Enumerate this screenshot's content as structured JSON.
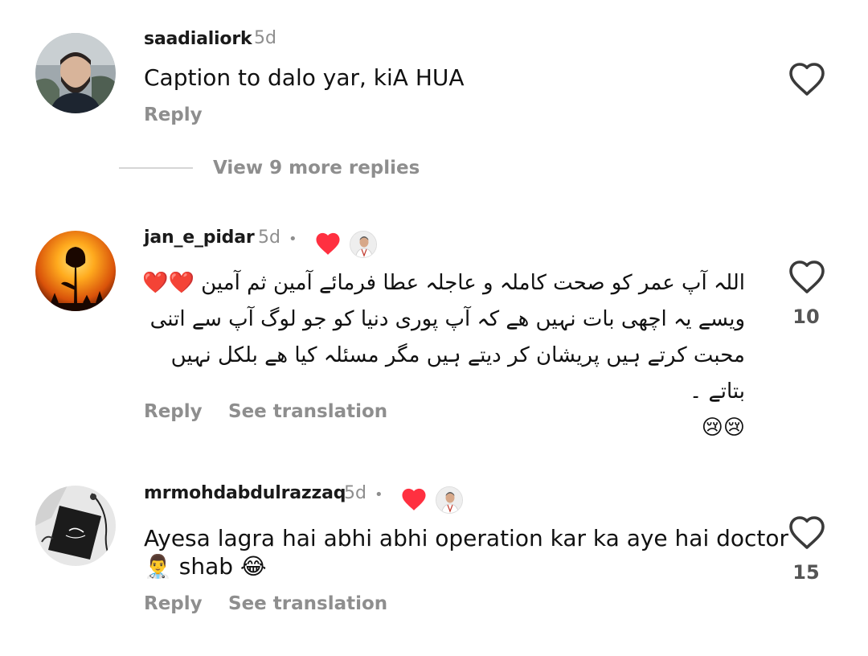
{
  "comments": [
    {
      "username": "saadialiork",
      "time": "5d",
      "text": "Caption to dalo yar, kiA HUA",
      "reply_label": "Reply"
    },
    {
      "username": "jan_e_pidar",
      "time": "5d",
      "text_lines": [
        "اللہ آپ عمر کو صحت کاملہ و عاجلہ عطا فرمائے آمین ثم آمین ❤️❤️",
        "ویسے یہ اچھی بات نہیں ھے کہ آپ پوری دنیا کو جو لوگ آپ سے اتنی",
        "محبت کرتے ہیں پریشان کر دیتے ہیں مگر  مسئلہ کیا ھے بلکل نہیں بتاتے ۔",
        "😢😢"
      ],
      "like_count": "10",
      "reply_label": "Reply",
      "translate_label": "See translation"
    },
    {
      "username": "mrmohdabdulrazzaq",
      "time": "5d",
      "text_line1": "Ayesa lagra hai abhi abhi operation kar ka aye hai doctor",
      "text_line2": "👨‍⚕️ shab 😂",
      "like_count": "15",
      "reply_label": "Reply",
      "translate_label": "See translation"
    }
  ],
  "view_more_replies": "View 9 more replies",
  "separator_dot": "•",
  "colors": {
    "liked_heart": "#ff3040",
    "secondary_text": "#8e8e8e",
    "outline_icon": "#3a3a3a"
  }
}
